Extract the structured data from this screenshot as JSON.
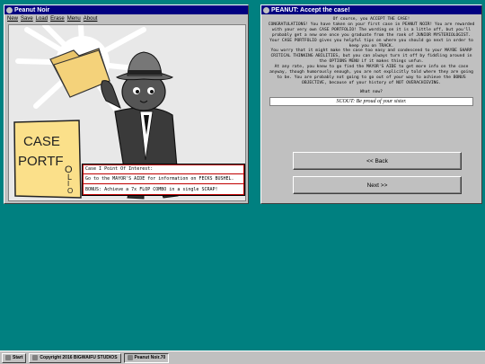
{
  "left_window": {
    "title": "Peanut Noir",
    "menu": [
      "New",
      "Save",
      "Load",
      "Erase",
      "Menu",
      "About"
    ],
    "portfolio_label": [
      "CASE",
      "PORTF",
      "O",
      "L",
      "I",
      "O"
    ],
    "info_lines": [
      "Case I Point Of Interest:",
      "Go to the MAYOR'S AIDE for information on FECKS BUSHEL.",
      "BONUS: Achieve a 7x FLOP COMBO in a single SCRAP!"
    ]
  },
  "right_window": {
    "title": "PEANUT: Accept the case!",
    "story": [
      "Of course, you ACCEPT THE CASE!",
      "CONGRATULATIONS! You have taken on your first case in PEANUT NOIR! You are rewarded with your very own CASE PORTFOLIO! The wording on it is a little off, but you'll probably get a new one once you graduate from the rank of JUNIOR MYSTERIOLOGIST.",
      "Your CASE PORTFOLIO gives you helpful tips on where you should go next in order to keep you on TRACK.",
      "You worry that it might make the case too easy and condescend to your MAYBE SHARP CRITICAL THINKING ABILITIES, but you can always turn it off by fiddling around in the OPTIONS MENU if it makes things unfun.",
      "At any rate, you knew to go find the MAYOR'S AIDE to get more info on the case anyway, though humorously enough, you are not explicitly told where they are going to be. You are probably not going to go out of your way to achieve the BONUS OBJECTIVE, because of your history of NOT OVERACHIEVING."
    ],
    "prompt": "What now?",
    "answer": "SCOUT: Be proud of your sister.",
    "back_label": "<< Back",
    "next_label": "Next >>"
  },
  "taskbar": {
    "start": "Start",
    "copyright": "Copyright 2016 BIGWAIFU STUDIOS",
    "app": "Peanut Noir.70"
  }
}
